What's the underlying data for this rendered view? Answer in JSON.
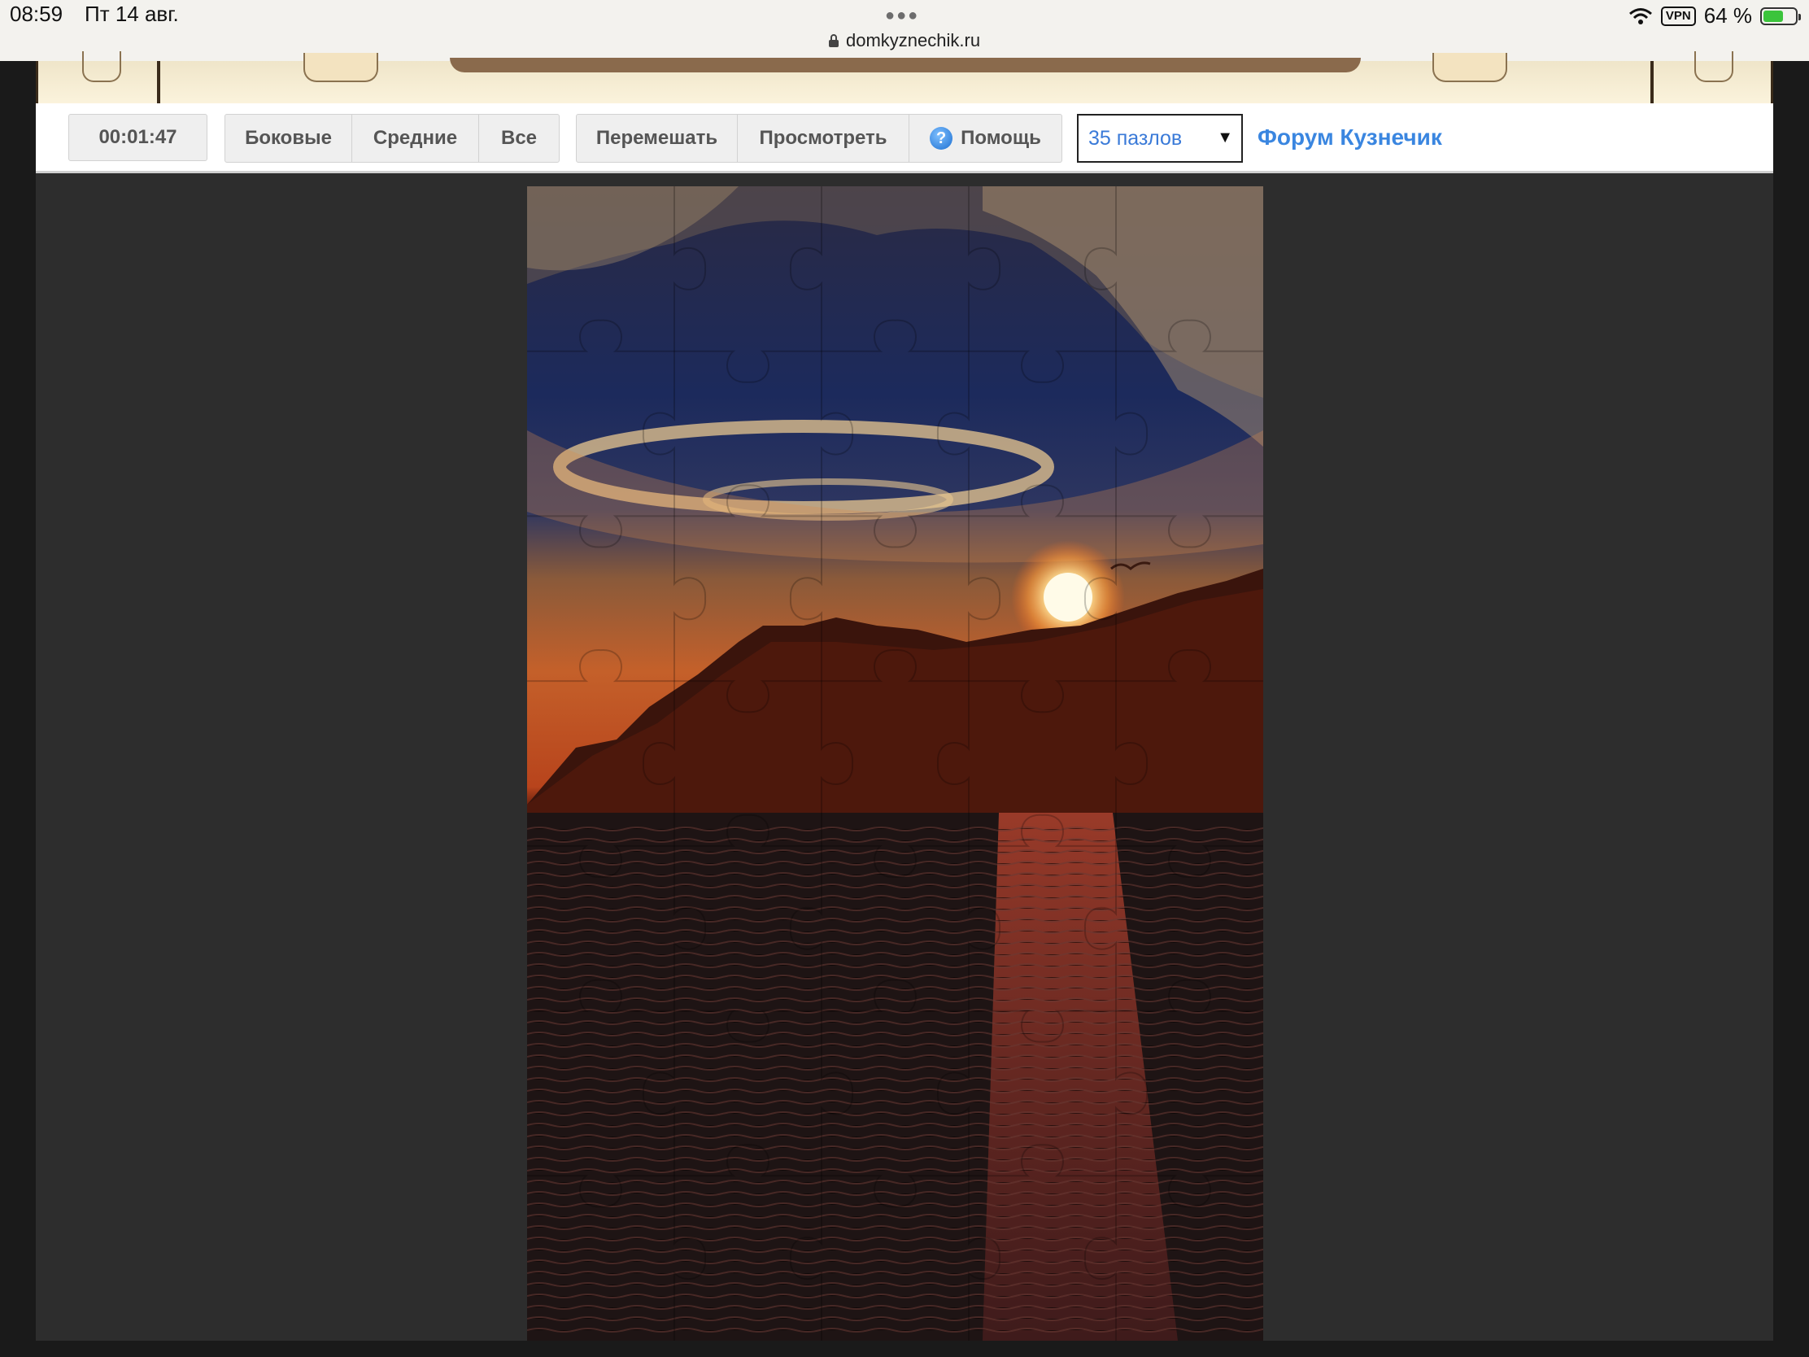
{
  "status_bar": {
    "time": "08:59",
    "date": "Пт 14 авг.",
    "url": "domkyznechik.ru",
    "vpn": "VPN",
    "battery": "64 %",
    "battery_level": 0.64
  },
  "toolbar": {
    "timer": "00:01:47",
    "filter_buttons": [
      "Боковые",
      "Средние",
      "Все"
    ],
    "shuffle_label": "Перемешать",
    "preview_label": "Просмотреть",
    "help_label": "Помощь",
    "piece_count_selected": "35 пазлов",
    "forum_link": "Форум Кузнечик"
  },
  "colors": {
    "link": "#3a86e0",
    "select_text": "#3a7ad8",
    "play_background": "#2d2d2d"
  },
  "puzzle": {
    "columns": 5,
    "rows": 7,
    "pieces": 35
  }
}
